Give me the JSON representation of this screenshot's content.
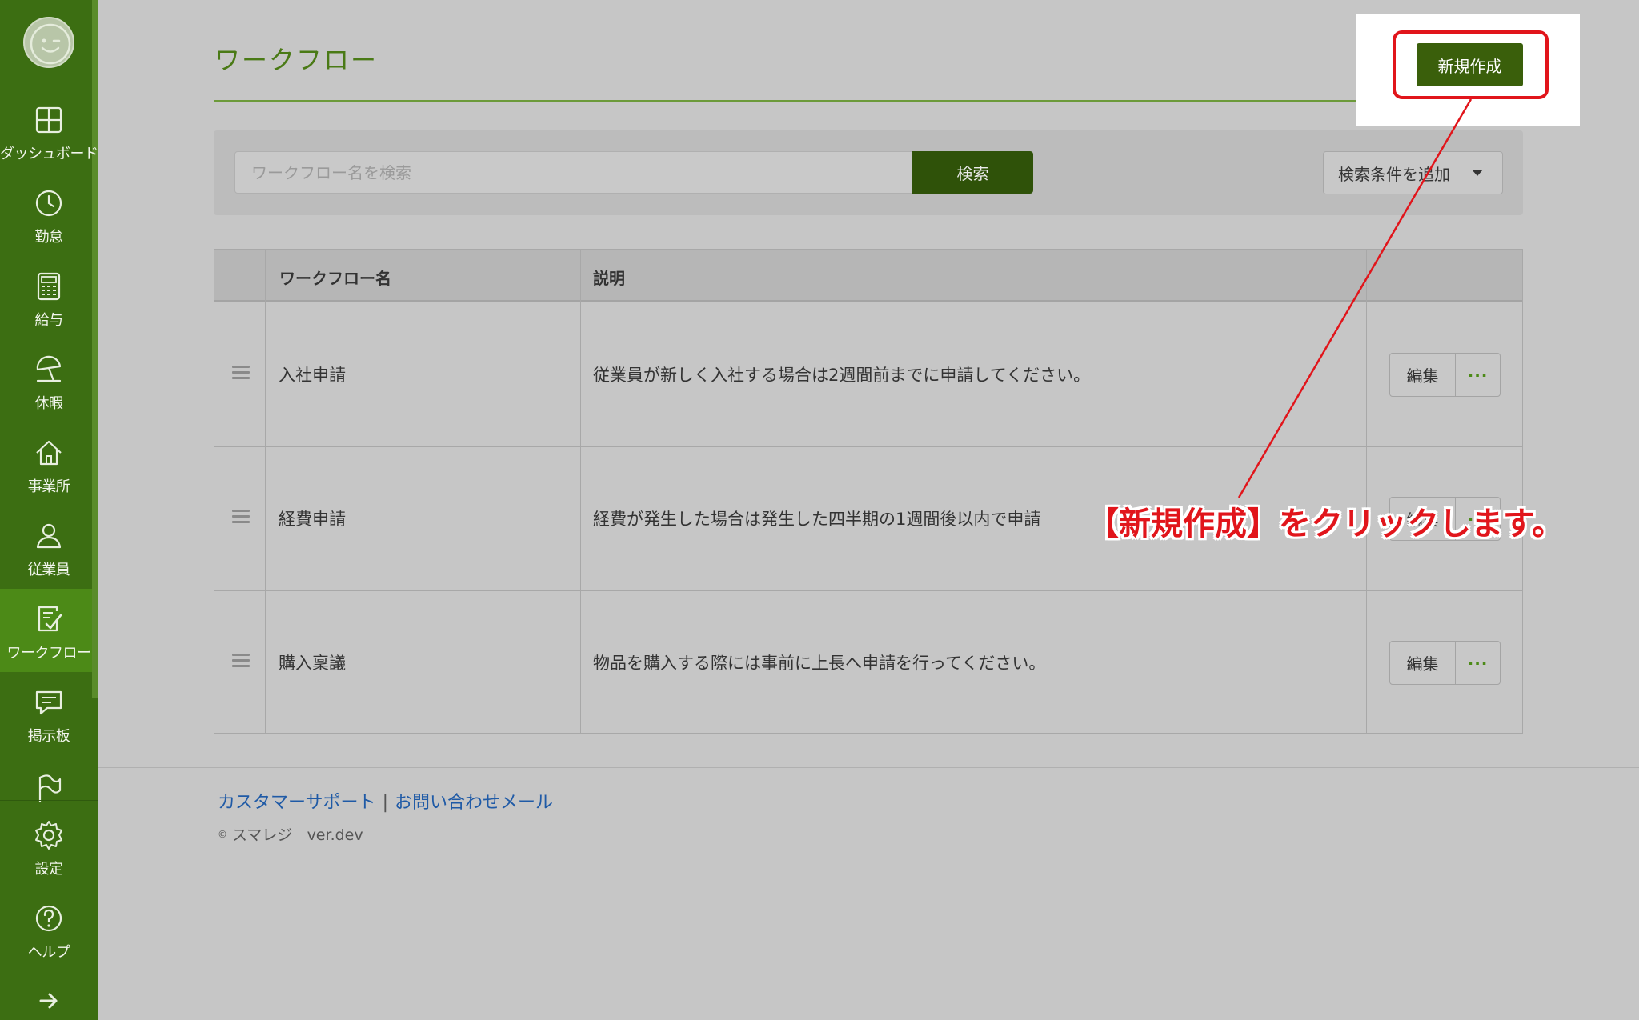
{
  "sidebar": {
    "items": [
      {
        "label": "ダッシュボード",
        "icon": "dashboard-icon"
      },
      {
        "label": "勤怠",
        "icon": "clock-icon"
      },
      {
        "label": "給与",
        "icon": "calculator-icon"
      },
      {
        "label": "休暇",
        "icon": "beach-umbrella-icon"
      },
      {
        "label": "事業所",
        "icon": "home-icon"
      },
      {
        "label": "従業員",
        "icon": "person-icon"
      },
      {
        "label": "ワークフロー",
        "icon": "workflow-check-icon"
      },
      {
        "label": "掲示板",
        "icon": "message-board-icon"
      },
      {
        "label": "",
        "icon": "flag-icon"
      },
      {
        "label": "設定",
        "icon": "gear-icon"
      },
      {
        "label": "ヘルプ",
        "icon": "help-icon"
      }
    ]
  },
  "header": {
    "title": "ワークフロー",
    "new_button": "新規作成"
  },
  "search": {
    "placeholder": "ワークフロー名を検索",
    "button": "検索",
    "filter_button": "検索条件を追加"
  },
  "table": {
    "headers": [
      "ワークフロー名",
      "説明"
    ],
    "rows": [
      {
        "name": "入社申請",
        "description": "従業員が新しく入社する場合は2週間前までに申請してください。"
      },
      {
        "name": "経費申請",
        "description": "経費が発生した場合は発生した四半期の1週間後以内で申請"
      },
      {
        "name": "購入稟議",
        "description": "物品を購入する際には事前に上長へ申請を行ってください。"
      }
    ],
    "edit_label": "編集",
    "more_label": "···"
  },
  "footer": {
    "support_link": "カスタマーサポート",
    "separator": "|",
    "contact_link": "お問い合わせメール",
    "copyright_symbol": "©",
    "company": "スマレジ",
    "version": "ver.dev"
  },
  "annotation": {
    "text": "【新規作成】をクリックします。",
    "color": "#e1151b"
  },
  "colors": {
    "sidebar": "#3c6e12",
    "accent": "#3a5f0b"
  }
}
